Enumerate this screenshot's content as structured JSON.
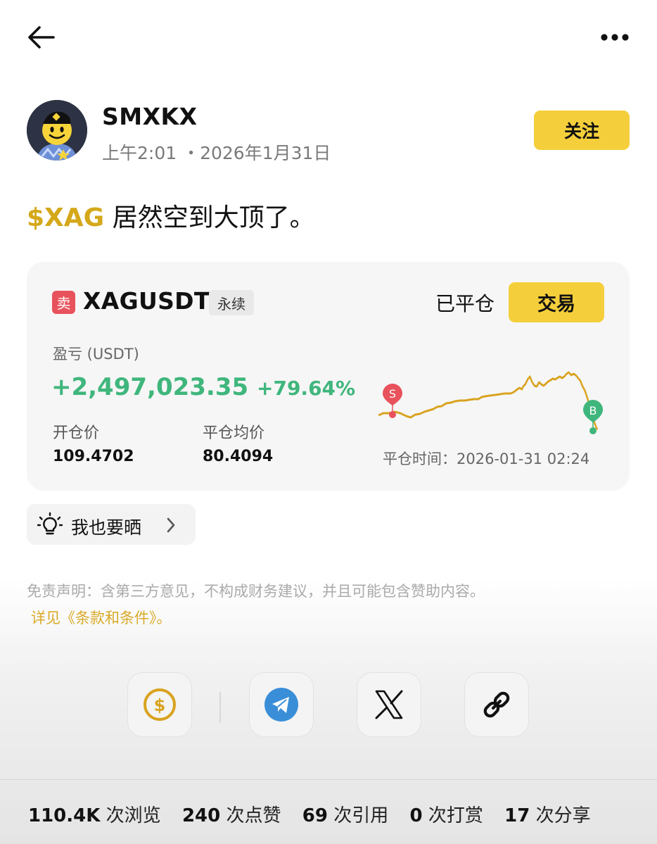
{
  "header": {
    "back_icon": "arrow-left-icon",
    "more_icon": "more-dots-icon"
  },
  "author": {
    "name": "SMXKX",
    "time": "上午2:01 ・2026年1月31日",
    "follow_label": "关注"
  },
  "post": {
    "ticker": "$XAG",
    "text": " 居然空到大顶了。"
  },
  "trade_card": {
    "side": "卖",
    "symbol": "XAGUSDT",
    "contract_type": "永续",
    "status": "已平仓",
    "trade_label": "交易",
    "pnl_label": "盈亏 (USDT)",
    "pnl_value": "+2,497,023.35",
    "pnl_percent": "+79.64%",
    "open_price_label": "开仓价",
    "open_price": "109.4702",
    "close_price_label": "平仓均价",
    "close_price": "80.4094",
    "close_time_label": "平仓时间：",
    "close_time": "2026-01-31 02:24",
    "chart": {
      "sell_marker": "S",
      "buy_marker": "B",
      "line_color": "#d9a320",
      "sell_color": "#e8525c",
      "buy_color": "#3fb67c"
    }
  },
  "share_mine": {
    "label": "我也要晒",
    "icon": "lightbulb-icon"
  },
  "disclaimer": {
    "text": "免责声明：含第三方意见，不构成财务建议，并且可能包含赞助内容。",
    "link": "详见《条款和条件》。"
  },
  "actions": [
    {
      "name": "tip",
      "icon": "dollar-coin-icon"
    },
    {
      "name": "telegram",
      "icon": "telegram-icon"
    },
    {
      "name": "x",
      "icon": "x-logo-icon"
    },
    {
      "name": "copy-link",
      "icon": "link-icon"
    }
  ],
  "stats": {
    "views_num": "110.4K",
    "views_label": "次浏览",
    "likes_num": "240",
    "likes_label": "次点赞",
    "quotes_num": "69",
    "quotes_label": "次引用",
    "tips_num": "0",
    "tips_label": "次打赏",
    "shares_num": "17",
    "shares_label": "次分享"
  },
  "colors": {
    "accent": "#f5cf3b",
    "profit": "#3fb67c",
    "sell": "#e8525c",
    "link": "#d9a928"
  }
}
